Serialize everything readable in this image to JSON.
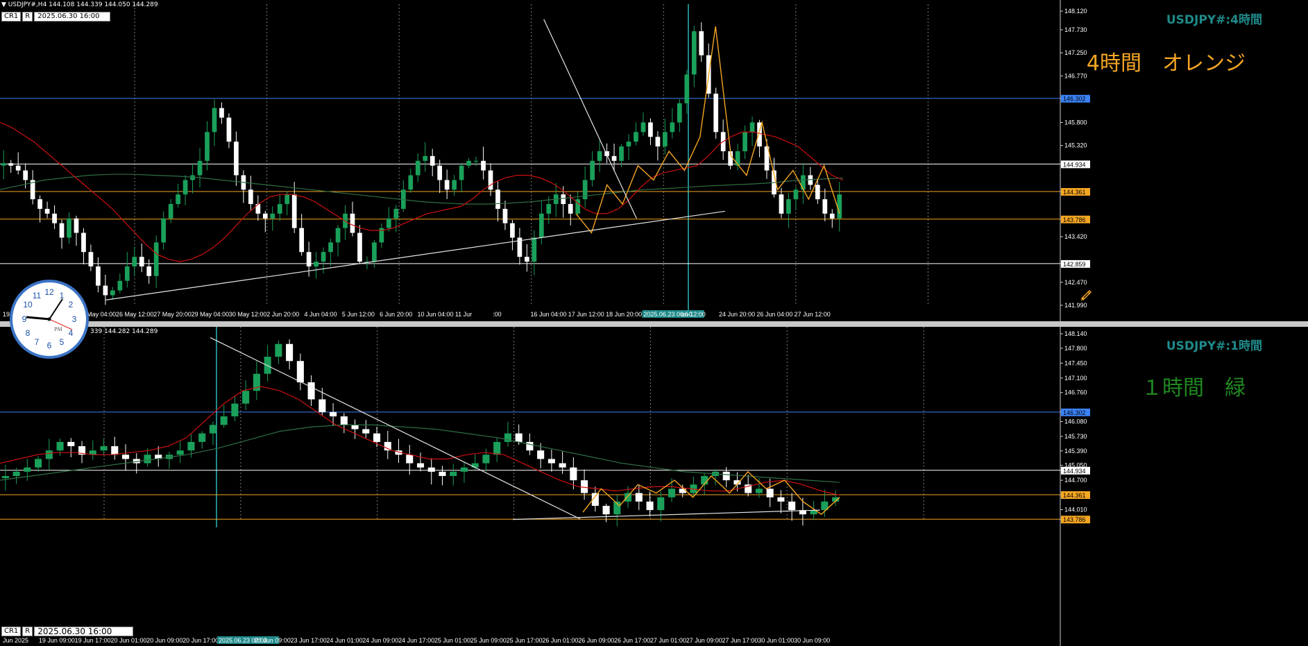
{
  "colors": {
    "background": "#000000",
    "grid": "#b4b4b4",
    "bull": "#1aa05a",
    "bear": "#ffffff",
    "ma_fast": "#d01010",
    "ma_slow": "#2f6e45",
    "zigzag": "#f5a623",
    "orange_level": "#f5a623",
    "blue_level": "#3b82f6",
    "white_level": "#ffffff",
    "title_teal": "#1f8a8a",
    "note_orange": "#f5a623",
    "note_green": "#1f8a1f"
  },
  "icons": [
    "clock-icon",
    "pencil-tool-icon",
    "pane-menu-icon"
  ],
  "h4": {
    "header": "USDJPY#,H4  144.108 144.339 144.050 144.289",
    "cr_label": "CR1",
    "r_label": "R",
    "date_box": "2025.06.30 16:00",
    "title": "USDJPY#:4時間",
    "note": "4時間　オレンジ",
    "level_labels": {
      "blue": "146.302",
      "white_top": "144.934",
      "orange_top": "144.361",
      "orange_bottom": "143.786",
      "white_bottom": "142.859"
    }
  },
  "h1": {
    "header": "339 144.282 144.289",
    "cr_label": "CR1",
    "r_label": "R",
    "date_box": "2025.06.30 16:00",
    "title": "USDJPY#:1時間",
    "note": "１時間　緑",
    "level_labels": {
      "blue": "146.302",
      "white_top": "144.934",
      "orange_top": "144.361",
      "orange_bottom": "143.786"
    }
  },
  "chart_data": [
    {
      "type": "candlestick",
      "title": "USDJPY#:4時間",
      "symbol": "USDJPY#",
      "timeframe": "H4",
      "ohlc_header": [
        144.108,
        144.339,
        144.05,
        144.289
      ],
      "ylim": [
        141.99,
        148.12
      ],
      "y_ticks": [
        "148.120",
        "147.730",
        "147.250",
        "146.770",
        "146.302",
        "145.800",
        "145.320",
        "144.934",
        "144.361",
        "143.786",
        "143.420",
        "142.859",
        "142.470",
        "141.990"
      ],
      "x_ticks": [
        "19",
        "21 May 20:00",
        "23 May 04:00",
        "26 May 12:00",
        "27 May 20:00",
        "29 May 04:00",
        "30 May 12:00",
        "2 Jun 20:00",
        "4 Jun 04:00",
        "5 Jun 12:00",
        "6 Jun 20:00",
        "10 Jun 04:00",
        "11 Jur",
        ":00",
        "16 Jun 04:00",
        "17 Jun 12:00",
        "18 Jun 20:00",
        "2025.06.23 00:00",
        "un 12:00",
        "24 Jun 20:00",
        "26 Jun 04:00",
        "27 Jun 12:00"
      ],
      "horizontal_levels": [
        {
          "name": "blue",
          "value": 146.302
        },
        {
          "name": "white_top",
          "value": 144.934
        },
        {
          "name": "orange_top",
          "value": 144.361
        },
        {
          "name": "orange_bottom",
          "value": 143.786
        },
        {
          "name": "white_bottom",
          "value": 142.859
        }
      ],
      "close_path": [
        144.95,
        144.9,
        144.8,
        144.6,
        144.2,
        144.0,
        143.9,
        143.7,
        143.4,
        143.8,
        143.5,
        143.1,
        142.8,
        142.4,
        142.2,
        142.3,
        142.5,
        142.8,
        143.0,
        142.8,
        142.6,
        143.3,
        143.8,
        144.1,
        144.3,
        144.6,
        144.7,
        145.0,
        145.6,
        146.1,
        145.9,
        145.4,
        144.7,
        144.4,
        144.1,
        143.9,
        143.8,
        143.9,
        144.1,
        144.3,
        143.6,
        143.1,
        142.8,
        142.9,
        143.1,
        143.3,
        143.6,
        143.9,
        143.5,
        142.9,
        142.9,
        143.3,
        143.6,
        143.8,
        144.0,
        144.4,
        144.7,
        145.0,
        145.1,
        144.9,
        144.6,
        144.4,
        144.6,
        144.9,
        145.0,
        145.0,
        144.8,
        144.4,
        144.0,
        143.7,
        143.4,
        143.0,
        142.9,
        143.4,
        143.9,
        144.1,
        144.3,
        144.1,
        143.9,
        144.2,
        144.6,
        145.0,
        145.2,
        145.1,
        145.0,
        145.3,
        145.4,
        145.6,
        145.8,
        145.5,
        145.3,
        145.6,
        145.8,
        146.2,
        146.8,
        147.7,
        147.2,
        146.4,
        145.6,
        145.2,
        144.9,
        145.2,
        145.6,
        145.8,
        145.3,
        144.8,
        144.3,
        143.9,
        144.2,
        144.4,
        144.7,
        144.5,
        144.2,
        143.9,
        143.8,
        144.3
      ],
      "ma_fast": [
        145.8,
        145.7,
        145.55,
        145.4,
        145.2,
        145.0,
        144.8,
        144.6,
        144.4,
        144.2,
        144.0,
        143.75,
        143.5,
        143.25,
        143.05,
        142.95,
        142.9,
        142.95,
        143.05,
        143.2,
        143.4,
        143.65,
        143.9,
        144.1,
        144.25,
        144.3,
        144.3,
        144.25,
        144.15,
        144.0,
        143.85,
        143.7,
        143.6,
        143.55,
        143.55,
        143.6,
        143.7,
        143.8,
        143.9,
        143.95,
        144.0,
        144.05,
        144.2,
        144.4,
        144.55,
        144.65,
        144.7,
        144.7,
        144.65,
        144.55,
        144.4,
        144.2,
        144.0,
        143.9,
        143.9,
        144.0,
        144.2,
        144.45,
        144.65,
        144.75,
        144.8,
        144.85,
        144.9,
        145.1,
        145.35,
        145.5,
        145.6,
        145.6,
        145.55,
        145.5,
        145.4,
        145.3,
        145.1,
        144.9,
        144.7,
        144.6
      ],
      "ma_slow": [
        144.4,
        144.5,
        144.6,
        144.65,
        144.7,
        144.72,
        144.72,
        144.7,
        144.68,
        144.65,
        144.6,
        144.55,
        144.5,
        144.45,
        144.4,
        144.35,
        144.3,
        144.25,
        144.2,
        144.15,
        144.12,
        144.1,
        144.1,
        144.12,
        144.15,
        144.2,
        144.25,
        144.3,
        144.35,
        144.4,
        144.42,
        144.45,
        144.48,
        144.5,
        144.52,
        144.55,
        144.6,
        144.62,
        144.64
      ],
      "zigzag": [
        143.9,
        143.5,
        144.5,
        144.1,
        144.9,
        144.6,
        145.2,
        144.8,
        145.5,
        147.8,
        145.1,
        144.7,
        145.8,
        144.4,
        144.8,
        144.2,
        144.9,
        143.9
      ],
      "trendlines": [
        {
          "name": "rising_support",
          "from": [
            0.125,
            142.1
          ],
          "to": [
            0.86,
            143.95
          ]
        },
        {
          "name": "falling_resistance",
          "from": [
            0.645,
            147.95
          ],
          "to": [
            0.755,
            143.8
          ]
        }
      ]
    },
    {
      "type": "candlestick",
      "title": "USDJPY#:1時間",
      "symbol": "USDJPY#",
      "timeframe": "H1",
      "ohlc_header": [
        144.282,
        144.289
      ],
      "ylim": [
        143.79,
        148.14
      ],
      "y_ticks": [
        "148.140",
        "147.800",
        "147.450",
        "147.100",
        "146.760",
        "146.302",
        "146.080",
        "145.730",
        "145.390",
        "145.050",
        "144.934",
        "144.700",
        "144.361",
        "144.010",
        "143.786"
      ],
      "x_ticks": [
        "Jun 2025",
        "19 Jun 09:00",
        "19 Jun 17:00",
        "20 Jun 01:00",
        "20 Jun 09:00",
        "20 Jun 17:00",
        "2025.06.23 00:00",
        "23 Jun 09:00",
        "23 Jun 17:00",
        "24 Jun 01:00",
        "24 Jun 09:00",
        "24 Jun 17:00",
        "25 Jun 01:00",
        "25 Jun 09:00",
        "25 Jun 17:00",
        "26 Jun 01:00",
        "26 Jun 09:00",
        "26 Jun 17:00",
        "27 Jun 01:00",
        "27 Jun 09:00",
        "27 Jun 17:00",
        "30 Jun 01:00",
        "30 Jun 09:00"
      ],
      "horizontal_levels": [
        {
          "name": "blue",
          "value": 146.302
        },
        {
          "name": "white_top",
          "value": 144.934
        },
        {
          "name": "orange_top",
          "value": 144.361
        },
        {
          "name": "orange_bottom",
          "value": 143.786
        }
      ],
      "close_path": [
        144.8,
        144.9,
        145.0,
        145.2,
        145.4,
        145.6,
        145.5,
        145.3,
        145.4,
        145.5,
        145.3,
        145.2,
        145.1,
        145.3,
        145.2,
        145.3,
        145.4,
        145.6,
        145.8,
        146.0,
        146.2,
        146.5,
        146.8,
        147.2,
        147.6,
        147.9,
        147.5,
        147.0,
        146.6,
        146.3,
        146.2,
        146.0,
        145.9,
        145.8,
        145.6,
        145.4,
        145.3,
        145.1,
        145.0,
        144.9,
        144.8,
        144.9,
        145.0,
        145.1,
        145.3,
        145.6,
        145.8,
        145.6,
        145.4,
        145.2,
        145.1,
        145.0,
        144.7,
        144.4,
        144.1,
        143.9,
        144.2,
        144.4,
        144.2,
        144.0,
        144.3,
        144.5,
        144.4,
        144.6,
        144.8,
        144.9,
        144.7,
        144.6,
        144.4,
        144.5,
        144.3,
        144.2,
        144.0,
        143.9,
        144.0,
        144.2,
        144.3
      ],
      "ma_fast": [
        145.1,
        145.2,
        145.3,
        145.35,
        145.35,
        145.3,
        145.3,
        145.35,
        145.4,
        145.5,
        145.7,
        146.1,
        146.5,
        146.8,
        146.9,
        146.8,
        146.6,
        146.3,
        146.0,
        145.8,
        145.6,
        145.4,
        145.3,
        145.2,
        145.2,
        145.3,
        145.35,
        145.3,
        145.1,
        144.9,
        144.7,
        144.55,
        144.5,
        144.45,
        144.5,
        144.55,
        144.55,
        144.5,
        144.45,
        144.45,
        144.55,
        144.65,
        144.7,
        144.6,
        144.45,
        144.35
      ],
      "ma_slow": [
        144.7,
        144.8,
        144.9,
        145.0,
        145.1,
        145.2,
        145.3,
        145.45,
        145.65,
        145.85,
        145.95,
        146.0,
        146.0,
        145.95,
        145.9,
        145.8,
        145.7,
        145.55,
        145.4,
        145.25,
        145.1,
        145.0,
        144.9,
        144.85,
        144.8,
        144.75,
        144.7,
        144.65
      ],
      "zigzag": [
        143.95,
        144.5,
        144.1,
        144.6,
        144.4,
        144.7,
        144.3,
        144.8,
        144.4,
        144.9,
        144.5,
        144.7,
        144.2,
        143.9,
        144.3
      ],
      "trendlines": [
        {
          "name": "falling_resistance",
          "from": [
            0.25,
            148.05
          ],
          "to": [
            0.69,
            143.79
          ]
        },
        {
          "name": "rising_support",
          "from": [
            0.61,
            143.78
          ],
          "to": [
            0.975,
            144.0
          ]
        }
      ]
    }
  ]
}
